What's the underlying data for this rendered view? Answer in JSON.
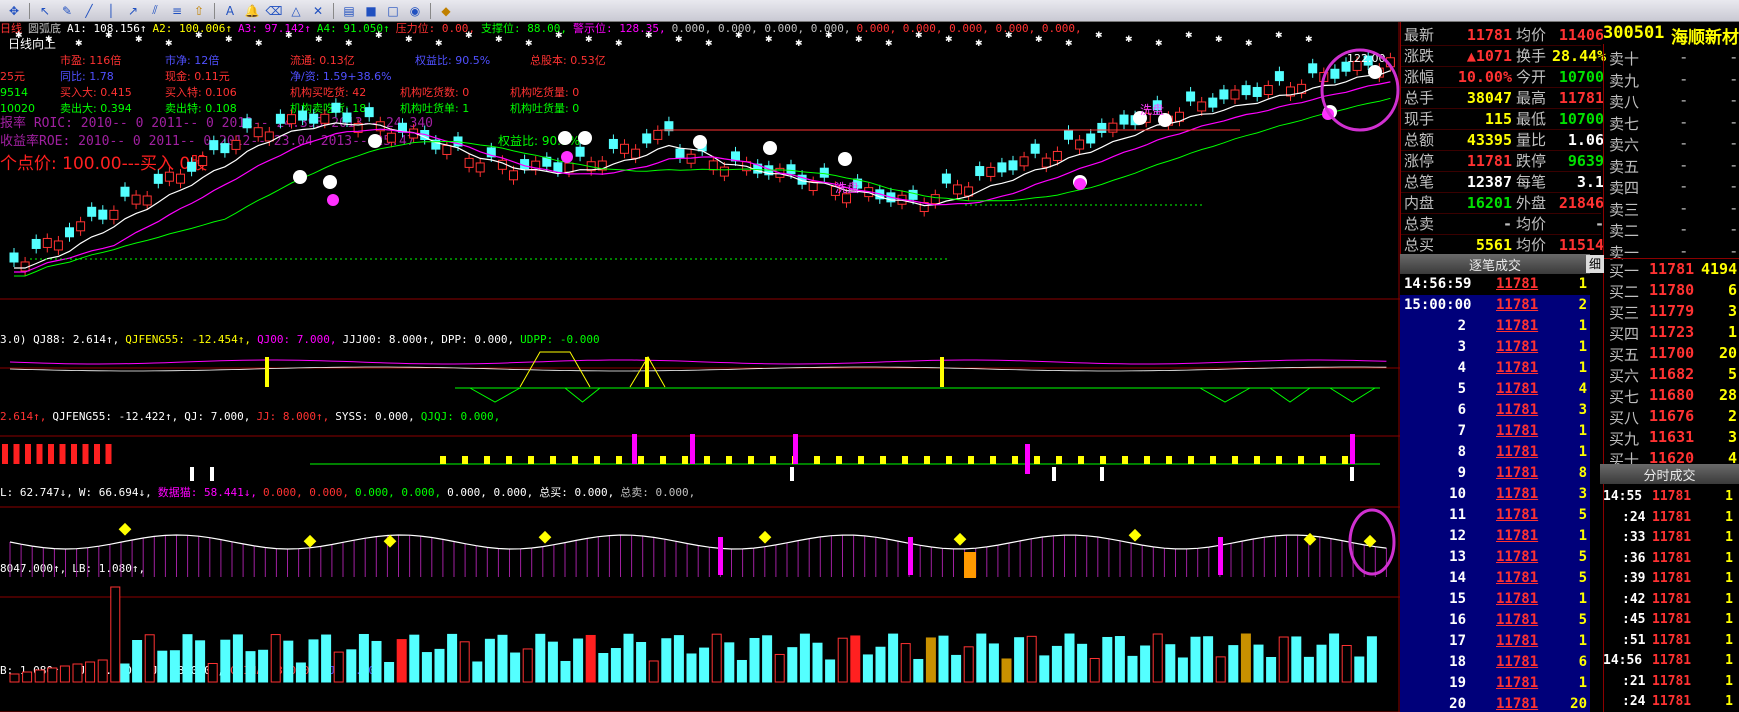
{
  "toolbar": {
    "icons": [
      "move-icon",
      "cursor-icon",
      "pen-icon",
      "line-icon",
      "vertical-line-icon",
      "ray-icon",
      "channel-icon",
      "fib-icon",
      "arrow-up-icon",
      "text-icon",
      "bell-icon",
      "eraser-icon",
      "triangle-icon",
      "delete-icon",
      "clipboard-icon",
      "lock-icon",
      "unlock-icon",
      "visibility-icon",
      "diamond-icon"
    ]
  },
  "main_pane": {
    "header": [
      {
        "text": "日线",
        "color": "#ff3232"
      },
      {
        "text": "圆弧底",
        "color": "#c0c0c0"
      },
      {
        "text": "A1: 108.156↑",
        "color": "#ffffff"
      },
      {
        "text": "A2: 100.006↑",
        "color": "#ffff00"
      },
      {
        "text": "A3: 97.142↑",
        "color": "#ff00ff"
      },
      {
        "text": "A4: 91.050↑",
        "color": "#00ff00"
      },
      {
        "text": "压力位: 0.00,",
        "color": "#ff3232"
      },
      {
        "text": "支撑位: 88.00,",
        "color": "#00ff00"
      },
      {
        "text": "警示位: 128.35,",
        "color": "#ff00ff"
      },
      {
        "text": "0.000, 0.000, 0.000, 0.000,",
        "color": "#c0c0c0"
      },
      {
        "text": "0.000, 0.000, 0.000, 0.000, 0.000,",
        "color": "#ff3232"
      }
    ],
    "trend_label": "日线向上",
    "info_lines": [
      [
        {
          "t": "市盈: 116倍",
          "c": "#ff3232"
        },
        {
          "t": "市净: 12倍",
          "c": "#5050ff"
        },
        {
          "t": "流通: 0.13亿",
          "c": "#ff3232"
        },
        {
          "t": "权益比: 90.5%",
          "c": "#5050ff"
        },
        {
          "t": "总股本: 0.53亿",
          "c": "#ff3232"
        }
      ],
      [
        {
          "t": "25元",
          "c": "#ff3232"
        },
        {
          "t": "同比: 1.78",
          "c": "#5050ff"
        },
        {
          "t": "现金: 0.11元",
          "c": "#ff3232"
        },
        {
          "t": "净/资: 1.59+38.6%",
          "c": "#5050ff"
        }
      ],
      [
        {
          "t": "9514",
          "c": "#00ff00"
        },
        {
          "t": "买入大: 0.415",
          "c": "#ff3232"
        },
        {
          "t": "买入特: 0.106",
          "c": "#ff3232"
        },
        {
          "t": "机构买吃货: 42",
          "c": "#ff3232"
        },
        {
          "t": "机构吃货数: 0",
          "c": "#ff3232"
        },
        {
          "t": "机构吃货量: 0",
          "c": "#ff3232"
        }
      ],
      [
        {
          "t": "10020",
          "c": "#00ff00"
        },
        {
          "t": "卖出大: 0.394",
          "c": "#00ff00"
        },
        {
          "t": "卖出特: 0.108",
          "c": "#00ff00"
        },
        {
          "t": "机构卖吃货: 18",
          "c": "#00ff00"
        },
        {
          "t": "机构吐货单: 1",
          "c": "#00ff00"
        },
        {
          "t": "机构吐货量: 0",
          "c": "#00ff00"
        }
      ]
    ],
    "roic_line": "报率 ROIC: 2010-- 0    2011-- 0    2012-- 24.395    2013-- 24.340",
    "roe_line": "收益率ROE: 2010-- 0    2011-- 0    2012-- 23.04    2013-- 25.47",
    "equity_ratio": "权益比: 90.5%",
    "buy_point": "个点价: 100.00---买入  0股",
    "annotation_wash": "洗盘",
    "annotation_hold": "洗盘",
    "price_high_label": "122.00",
    "colors": {
      "up": "#ff3232",
      "down": "#54ffff",
      "ma5": "#ffffff",
      "ma10": "#ff00ff",
      "ma20": "#00ff00"
    }
  },
  "indicator1": {
    "header": [
      {
        "t": "3.0) QJ88: 2.614↑,",
        "c": "#ffffff"
      },
      {
        "t": "QJFENG55: -12.454↑,",
        "c": "#ffff00"
      },
      {
        "t": "QJ00: 7.000,",
        "c": "#ff00ff"
      },
      {
        "t": "JJJ00: 8.000↑,",
        "c": "#ffffff"
      },
      {
        "t": "DPP: 0.000,",
        "c": "#ffffff"
      },
      {
        "t": "UDPP: -0.000",
        "c": "#00ff00"
      }
    ]
  },
  "indicator2": {
    "header": [
      {
        "t": "2.614↑,",
        "c": "#ff3232"
      },
      {
        "t": "QJFENG55: -12.422↑,",
        "c": "#ffffff"
      },
      {
        "t": "QJ: 7.000,",
        "c": "#ffffff"
      },
      {
        "t": "JJ: 8.000↑,",
        "c": "#ff3232"
      },
      {
        "t": "SYSS: 0.000,",
        "c": "#ffffff"
      },
      {
        "t": "QJQJ: 0.000,",
        "c": "#00ff00"
      }
    ]
  },
  "indicator3": {
    "header": [
      {
        "t": "L: 62.747↓,",
        "c": "#ffffff"
      },
      {
        "t": "W: 66.694↓,",
        "c": "#ffffff"
      },
      {
        "t": "数据猫: 58.441↓,",
        "c": "#ff00ff"
      },
      {
        "t": "0.000, 0.000,",
        "c": "#ff3232"
      },
      {
        "t": "0.000, 0.000,",
        "c": "#00ff00"
      },
      {
        "t": "0.000, 0.000,",
        "c": "#ffffff"
      },
      {
        "t": "总买: 0.000,",
        "c": "#ffffff"
      },
      {
        "t": "总卖: 0.000,",
        "c": "#c0c0c0"
      }
    ]
  },
  "indicator4": {
    "header": [
      {
        "t": "8047.000↑,",
        "c": "#ffffff"
      },
      {
        "t": "LB: 1.080↑,",
        "c": "#ffffff"
      }
    ]
  },
  "indicator5": {
    "header": [
      {
        "t": "B: 1.080↑,",
        "c": "#ffffff"
      },
      {
        "t": "BJ: 2.000,",
        "c": "#ffffff"
      },
      {
        "t": "ZJ: 23.000↑,",
        "c": "#ffffff"
      },
      {
        "t": "CHINA: 3.000,",
        "c": "#ff3232"
      },
      {
        "t": "FJ: 7.000",
        "c": "#5050ff"
      }
    ]
  },
  "quote": {
    "stock_code": "300501",
    "stock_name": "海顺新材",
    "rows": [
      {
        "l1": "最新",
        "v1": "11781",
        "c1": "#ff3232",
        "l2": "均价",
        "v2": "11406",
        "c2": "#ff3232"
      },
      {
        "l1": "涨跌",
        "v1": "▲1071",
        "c1": "#ff3232",
        "l2": "换手",
        "v2": "28.44%",
        "c2": "#ffff00"
      },
      {
        "l1": "涨幅",
        "v1": "10.00%",
        "c1": "#ff3232",
        "l2": "今开",
        "v2": "10700",
        "c2": "#00e000"
      },
      {
        "l1": "总手",
        "v1": "38047",
        "c1": "#ffff00",
        "l2": "最高",
        "v2": "11781",
        "c2": "#ff3232"
      },
      {
        "l1": "现手",
        "v1": "115",
        "c1": "#ffff00",
        "l2": "最低",
        "v2": "10700",
        "c2": "#00e000"
      },
      {
        "l1": "总额",
        "v1": "43395",
        "c1": "#ffff00",
        "l2": "量比",
        "v2": "1.06",
        "c2": "#ffffff"
      },
      {
        "l1": "涨停",
        "v1": "11781",
        "c1": "#ff3232",
        "l2": "跌停",
        "v2": "9639",
        "c2": "#00e000"
      },
      {
        "l1": "总笔",
        "v1": "12387",
        "c1": "#ffffff",
        "l2": "每笔",
        "v2": "3.1",
        "c2": "#ffffff"
      },
      {
        "l1": "内盘",
        "v1": "16201",
        "c1": "#00e000",
        "l2": "外盘",
        "v2": "21846",
        "c2": "#ff3232"
      },
      {
        "l1": "总卖",
        "v1": "-",
        "c1": "#c0c0c0",
        "l2": "均价",
        "v2": "-",
        "c2": "#c0c0c0"
      },
      {
        "l1": "总买",
        "v1": "5561",
        "c1": "#ffff00",
        "l2": "均价",
        "v2": "11514",
        "c2": "#ff3232"
      }
    ],
    "sell_levels": [
      {
        "label": "卖十",
        "price": "-",
        "vol": "-"
      },
      {
        "label": "卖九",
        "price": "-",
        "vol": "-"
      },
      {
        "label": "卖八",
        "price": "-",
        "vol": "-"
      },
      {
        "label": "卖七",
        "price": "-",
        "vol": "-"
      },
      {
        "label": "卖六",
        "price": "-",
        "vol": "-"
      },
      {
        "label": "卖五",
        "price": "-",
        "vol": "-"
      },
      {
        "label": "卖四",
        "price": "-",
        "vol": "-"
      },
      {
        "label": "卖三",
        "price": "-",
        "vol": "-"
      },
      {
        "label": "卖二",
        "price": "-",
        "vol": "-"
      },
      {
        "label": "卖一",
        "price": "-",
        "vol": "-"
      }
    ],
    "buy_levels": [
      {
        "label": "买一",
        "price": "11781",
        "vol": "4194"
      },
      {
        "label": "买二",
        "price": "11780",
        "vol": "6"
      },
      {
        "label": "买三",
        "price": "11779",
        "vol": "3"
      },
      {
        "label": "买四",
        "price": "11723",
        "vol": "1"
      },
      {
        "label": "买五",
        "price": "11700",
        "vol": "20"
      },
      {
        "label": "买六",
        "price": "11682",
        "vol": "5"
      },
      {
        "label": "买七",
        "price": "11680",
        "vol": "28"
      },
      {
        "label": "买八",
        "price": "11676",
        "vol": "2"
      },
      {
        "label": "买九",
        "price": "11631",
        "vol": "3"
      },
      {
        "label": "买十",
        "price": "11620",
        "vol": "4"
      }
    ],
    "trades_header": "逐笔成交",
    "trades_tab": "细",
    "trades": [
      {
        "t": "14:56:59",
        "p": "11781",
        "v": "1"
      },
      {
        "t": "15:00:00",
        "p": "11781",
        "v": "2"
      },
      {
        "t": "2",
        "p": "11781",
        "v": "1"
      },
      {
        "t": "3",
        "p": "11781",
        "v": "1"
      },
      {
        "t": "4",
        "p": "11781",
        "v": "1"
      },
      {
        "t": "5",
        "p": "11781",
        "v": "4"
      },
      {
        "t": "6",
        "p": "11781",
        "v": "3"
      },
      {
        "t": "7",
        "p": "11781",
        "v": "1"
      },
      {
        "t": "8",
        "p": "11781",
        "v": "1"
      },
      {
        "t": "9",
        "p": "11781",
        "v": "8"
      },
      {
        "t": "10",
        "p": "11781",
        "v": "3"
      },
      {
        "t": "11",
        "p": "11781",
        "v": "5"
      },
      {
        "t": "12",
        "p": "11781",
        "v": "1"
      },
      {
        "t": "13",
        "p": "11781",
        "v": "5"
      },
      {
        "t": "14",
        "p": "11781",
        "v": "5"
      },
      {
        "t": "15",
        "p": "11781",
        "v": "1"
      },
      {
        "t": "16",
        "p": "11781",
        "v": "5"
      },
      {
        "t": "17",
        "p": "11781",
        "v": "1"
      },
      {
        "t": "18",
        "p": "11781",
        "v": "6"
      },
      {
        "t": "19",
        "p": "11781",
        "v": "1"
      },
      {
        "t": "20",
        "p": "11781",
        "v": "20"
      }
    ],
    "minute_header": "分时成交",
    "minute_trades": [
      {
        "t": "14:55",
        "p": "11781",
        "v": "1"
      },
      {
        "t": ":24",
        "p": "11781",
        "v": "1"
      },
      {
        "t": ":33",
        "p": "11781",
        "v": "1"
      },
      {
        "t": ":36",
        "p": "11781",
        "v": "1"
      },
      {
        "t": ":39",
        "p": "11781",
        "v": "1"
      },
      {
        "t": ":42",
        "p": "11781",
        "v": "1"
      },
      {
        "t": ":45",
        "p": "11781",
        "v": "1"
      },
      {
        "t": ":51",
        "p": "11781",
        "v": "1"
      },
      {
        "t": "14:56",
        "p": "11781",
        "v": "1"
      },
      {
        "t": ":21",
        "p": "11781",
        "v": "1"
      },
      {
        "t": ":24",
        "p": "11781",
        "v": "1"
      }
    ]
  }
}
